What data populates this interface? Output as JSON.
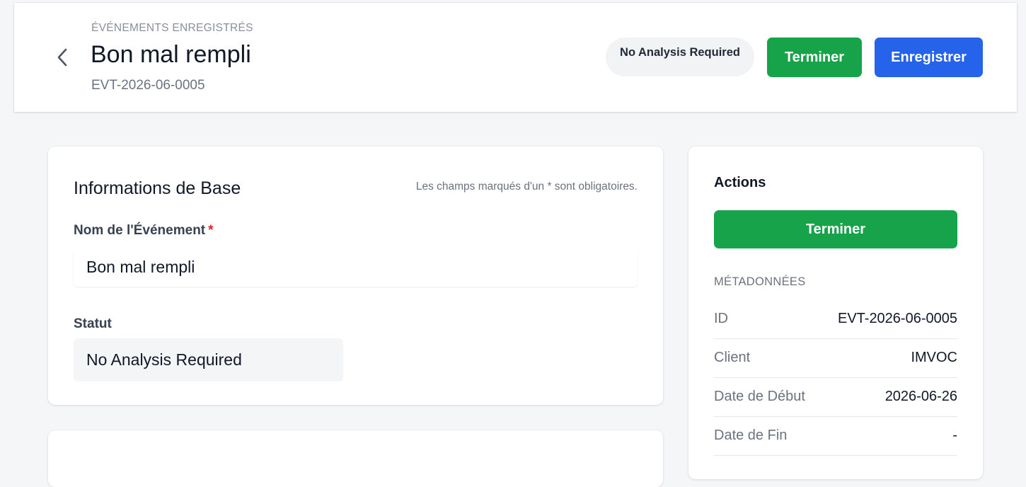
{
  "header": {
    "breadcrumb": "Événements enregistrés",
    "title": "Bon mal rempli",
    "event_id": "EVT-2026-06-0005",
    "status_badge": "No Analysis Required",
    "finish_button": "Terminer",
    "save_button": "Enregistrer"
  },
  "basic_info": {
    "title": "Informations de Base",
    "required_note": "Les champs marqués d'un * sont obligatoires.",
    "event_name_label": "Nom de l'Événement",
    "required_star": "*",
    "event_name_value": "Bon mal rempli",
    "status_label": "Statut",
    "status_value": "No Analysis Required"
  },
  "actions": {
    "title": "Actions",
    "finish_button": "Terminer",
    "metadata_label": "Métadonnées",
    "metadata": [
      {
        "key": "ID",
        "value": "EVT-2026-06-0005"
      },
      {
        "key": "Client",
        "value": "IMVOC"
      },
      {
        "key": "Date de Début",
        "value": "2026-06-26"
      },
      {
        "key": "Date de Fin",
        "value": "-"
      }
    ]
  },
  "colors": {
    "primary_green": "#16a34a",
    "primary_blue": "#2563eb",
    "required_red": "#dc2626"
  }
}
